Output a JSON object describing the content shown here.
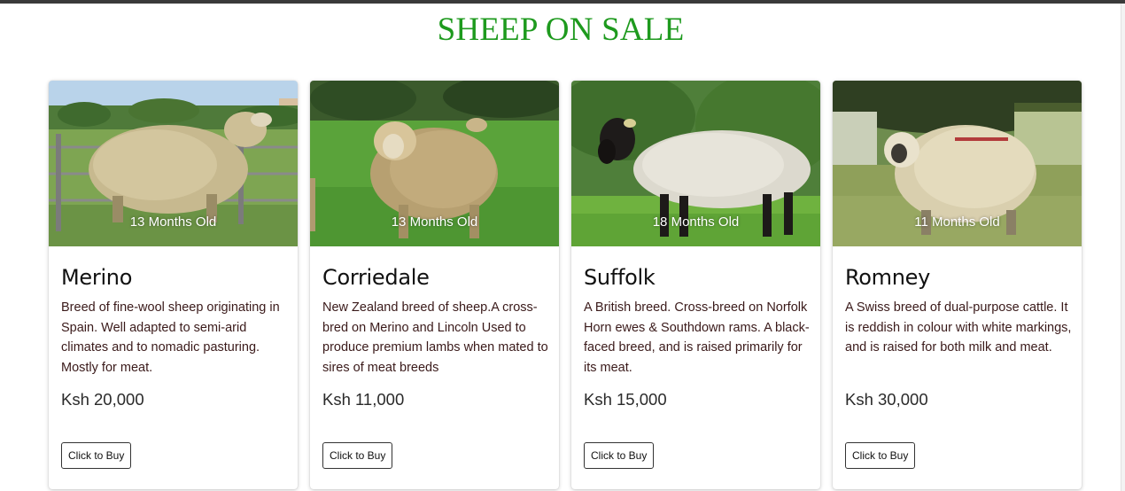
{
  "page": {
    "title": "SHEEP ON SALE"
  },
  "colors": {
    "title": "#1e9a1e",
    "button_border": "#333333",
    "description_text": "#3a1a1a"
  },
  "products": [
    {
      "name": "Merino",
      "age": "13 Months Old",
      "description": "Breed of fine-wool sheep originating in Spain. Well adapted to semi-arid climates and to nomadic pasturing. Mostly for meat.",
      "price": "Ksh 20,000",
      "button_label": "Click to Buy"
    },
    {
      "name": "Corriedale",
      "age": "13 Months Old",
      "description": "New Zealand breed of sheep.A cross-bred on Merino and Lincoln Used to produce premium lambs when mated to sires of meat breeds",
      "price": "Ksh 11,000",
      "button_label": "Click to Buy"
    },
    {
      "name": "Suffolk",
      "age": "18 Months Old",
      "description": "A British breed. Cross-breed on Norfolk Horn ewes & Southdown rams. A black-faced breed, and is raised primarily for its meat.",
      "price": "Ksh 15,000",
      "button_label": "Click to Buy"
    },
    {
      "name": "Romney",
      "age": "11 Months Old",
      "description": "A Swiss breed of dual-purpose cattle. It is reddish in colour with white markings, and is raised for both milk and meat.",
      "price": "Ksh 30,000",
      "button_label": "Click to Buy"
    }
  ]
}
